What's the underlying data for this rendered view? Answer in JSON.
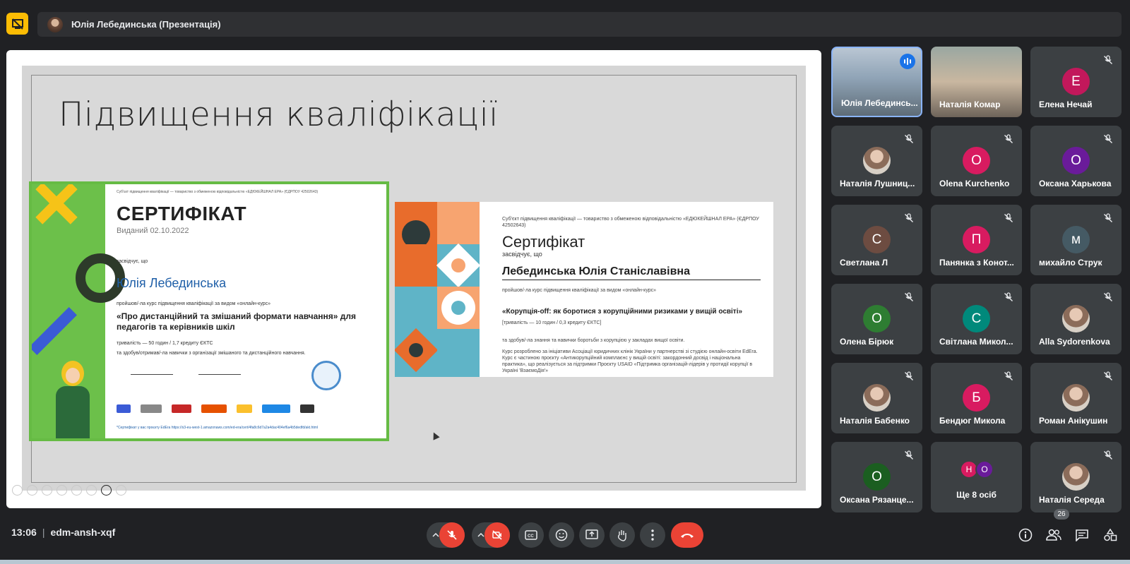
{
  "presenter": {
    "label": "Юлія Лебединська (Презентація)"
  },
  "slide": {
    "title": "Підвищення кваліфікації",
    "cert1": {
      "header_small": "Суб'єкт підвищення кваліфікації — товариство з обмеженою відповідальністю «ЕДЮКЕЙШНАЛ ЕРА» (ЄДРПОУ 42502643)",
      "title": "СЕРТИФІКАТ",
      "issued": "Виданий 02.10.2022",
      "certifies": "засвідчує, що",
      "name": "Юлія Лебединська",
      "passed": "пройшов/-ла курс підвищення кваліфікації за видом «онлайн-курс»",
      "course": "«Про дистанційний та змішаний формати навчання» для педагогів та керівників шкіл",
      "duration": "тривалість — 50 годин / 1,7 кредиту ЄКТС",
      "skills": "та здобув/отримав/-ла навички з організації змішаного та дистанційного навчання.",
      "footer_link": "*Сертифікат у вас проєкту EdEra https://s3-eu-west-1.amazonaws.com/ed-era/cert/4fa8c6d7a2a4dac404ef6a4b5dedfd/akt.html"
    },
    "cert2": {
      "header_small": "Суб'єкт підвищення кваліфікації — товариство з обмеженою відповідальністю «ЕДЮКЕЙШНАЛ ЕРА» (ЄДРПОУ 42502643)",
      "title": "Сертифікат",
      "certifies": "засвідчує, що",
      "name": "Лебединська Юлія Станіславівна",
      "passed": "пройшов/-ла курс підвищення кваліфікації за видом «онлайн-курс»",
      "course": "«Корупція-off: як боротися з корупційними ризиками у вищій освіті»",
      "duration": "[тривалість — 10 годин / 0,3 кредиту ЄКТС]",
      "skills": "та здобув/-ла знання та навички боротьби з корупцією у закладах вищої освіти.",
      "desc": "Курс розроблено за ініціативи Асоціації юридичних клінік України у партнерстві зі студією онлайн-освіти EdEra. Курс є частиною проєкту «Антикорупційний комплаєнс у вищій освіті: закордонний досвід і національна практика», що реалізується за підтримки Проєкту USAID «Підтримка організацій-лідерів у протидії корупції в Україні 'ВзаємоДія'»"
    }
  },
  "participants": [
    {
      "name": "Юлія Лебединсь...",
      "type": "video1",
      "speaking": true
    },
    {
      "name": "Наталія Комар",
      "type": "video2"
    },
    {
      "name": "Елена Нечай",
      "initial": "Е",
      "color": "#c2185b"
    },
    {
      "name": "Наталія Лушниц...",
      "photo": true
    },
    {
      "name": "Olena Kurchenko",
      "initial": "O",
      "color": "#d81b60"
    },
    {
      "name": "Оксана Харькова",
      "initial": "О",
      "color": "#6a1b9a"
    },
    {
      "name": "Светлана Л",
      "initial": "С",
      "color": "#6d4c41"
    },
    {
      "name": "Панянка з Конот...",
      "initial": "П",
      "color": "#d81b60"
    },
    {
      "name": "михайло Струк",
      "initial": "м",
      "color": "#455a64"
    },
    {
      "name": "Олена Бірюк",
      "initial": "О",
      "color": "#2e7d32"
    },
    {
      "name": "Світлана Микол...",
      "initial": "С",
      "color": "#00897b"
    },
    {
      "name": "Alla Sydorenkova",
      "photo": true
    },
    {
      "name": "Наталія Бабенко",
      "photo": true
    },
    {
      "name": "Бендюг Микола",
      "initial": "Б",
      "color": "#d81b60"
    },
    {
      "name": "Роман Анікушин",
      "photo": true
    },
    {
      "name": "Оксана Рязанце...",
      "initial": "О",
      "color": "#1b5e20"
    },
    {
      "name": "Ще 8 осіб",
      "more": true,
      "initials": [
        "Н",
        "О"
      ]
    },
    {
      "name": "Наталія Середа",
      "photo": true
    }
  ],
  "meeting": {
    "time": "13:06",
    "separator": "|",
    "code": "edm-ansh-xqf"
  },
  "people_count": "26",
  "colors": {
    "background": "#202124",
    "tile": "#3c4043",
    "danger": "#ea4335",
    "accent": "#fbbc04",
    "speaking": "#1a73e8"
  }
}
